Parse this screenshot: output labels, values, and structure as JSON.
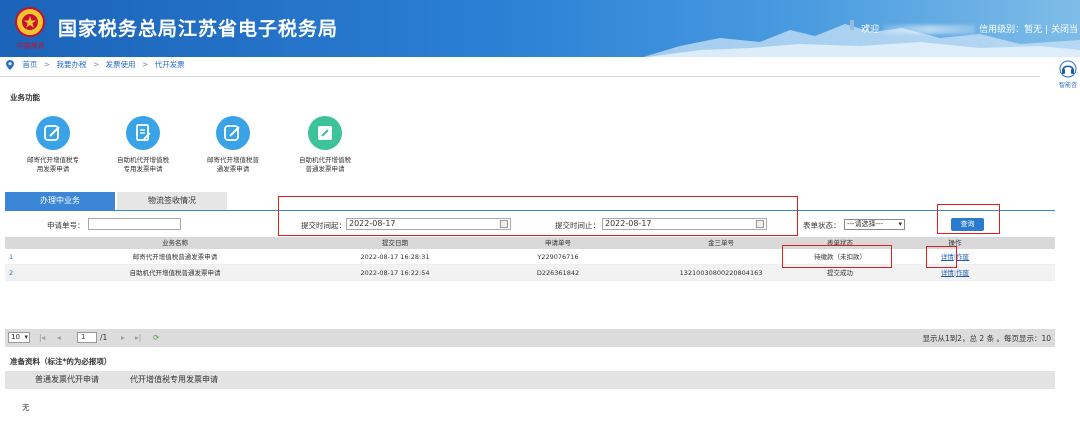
{
  "header": {
    "title": "国家税务总局江苏省电子税务局",
    "emblem_caption": "中国税务",
    "welcome": "欢迎",
    "credit_label": "信用级别：",
    "credit_value": "暂无",
    "divider": "|",
    "close_label": "关闭当"
  },
  "breadcrumb": {
    "items": [
      "首页",
      "我要办税",
      "发票使用",
      "代开发票"
    ],
    "separator": ">"
  },
  "assistant": {
    "label": "智能咨"
  },
  "functions": {
    "section_title": "业务功能",
    "items": [
      {
        "label_line1": "邮寄代开增值税专",
        "label_line2": "用发票申请",
        "icon": "edit-icon",
        "color": "#3aa3e8"
      },
      {
        "label_line1": "自助机代开增值税",
        "label_line2": "专用发票申请",
        "icon": "document-edit-icon",
        "color": "#3aa3e8"
      },
      {
        "label_line1": "邮寄代开增值税普",
        "label_line2": "通发票申请",
        "icon": "edit-icon",
        "color": "#3aa3e8"
      },
      {
        "label_line1": "自助机代开增值税",
        "label_line2": "普通发票申请",
        "icon": "pencil-note-icon",
        "color": "#3cc39a"
      }
    ]
  },
  "tabs": {
    "active": "办理中业务",
    "inactive": "物流签收情况"
  },
  "search": {
    "app_no_label": "申请单号：",
    "app_no_value": "",
    "from_label": "提交时间起：",
    "from_value": "2022-08-17",
    "to_label": "提交时间止：",
    "to_value": "2022-08-17",
    "status_label": "表单状态：",
    "status_value": "---请选择---",
    "query_button": "查询"
  },
  "table": {
    "columns": [
      "业务名称",
      "提交日期",
      "申请单号",
      "金三单号",
      "表单状态",
      "操作"
    ],
    "rows": [
      {
        "num": "1",
        "name": "邮寄代开增值税普通发票申请",
        "date": "2022-08-17 16:28:31",
        "app_no": "Y229076716",
        "jin3_no": "",
        "status": "待缴款（未扣款）",
        "detail": "详情",
        "sep": "|",
        "void": "作废"
      },
      {
        "num": "2",
        "name": "自助机代开增值税普通发票申请",
        "date": "2022-08-17 16:22:54",
        "app_no": "D226361842",
        "jin3_no": "13210030800220804163",
        "status": "提交成功",
        "detail": "详情",
        "sep": "|",
        "void": "作废"
      }
    ]
  },
  "pager": {
    "page_size": "10",
    "current_page": "1",
    "total_pages": "/1",
    "info": "显示从1到2，总 2 条 。每页显示：10"
  },
  "prepare": {
    "title": "准备资料（标注*的为必报项）",
    "tabs": [
      "普通发票代开申请",
      "代开增值税专用发票申请"
    ],
    "empty_text": "无"
  }
}
